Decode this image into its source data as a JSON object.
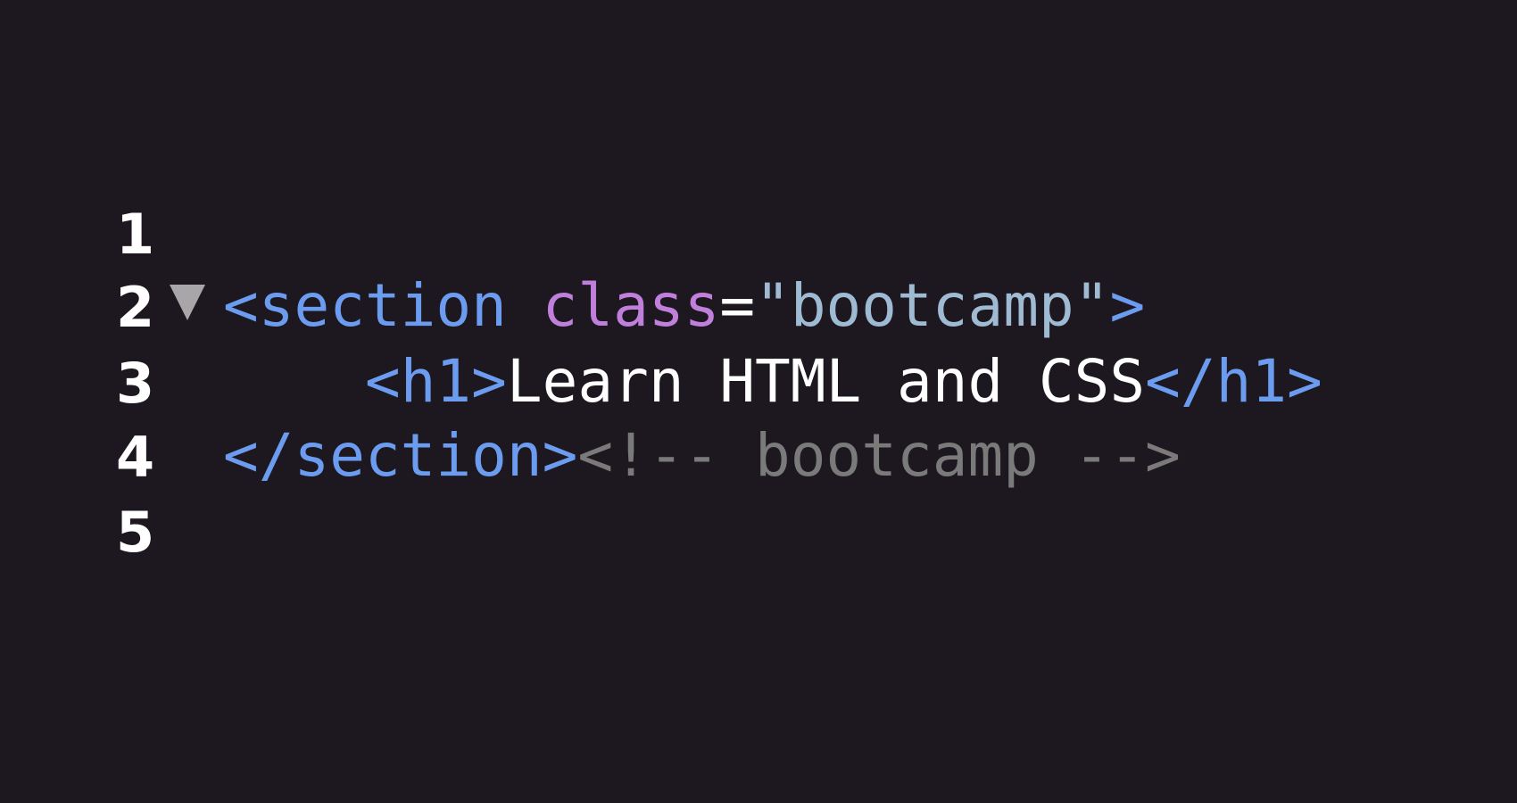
{
  "editor": {
    "colors": {
      "background": "#1d181f",
      "tag": "#6c9cef",
      "attribute": "#c17fdc",
      "string": "#9fbbd4",
      "text": "#ffffff",
      "comment": "#7a7a7a",
      "line_number": "#ffffff",
      "fold_icon": "#a8a6a9"
    },
    "fold_icon": "fold-triangle-down-icon",
    "lines": [
      {
        "number": "1"
      },
      {
        "number": "2",
        "tokens": {
          "open_tag": "<section",
          "space": " ",
          "attr_name": "class",
          "equals": "=",
          "attr_value": "\"bootcamp\"",
          "close_bracket": ">"
        }
      },
      {
        "number": "3",
        "tokens": {
          "indent": "    ",
          "open_tag": "<h1>",
          "text": "Learn HTML and CSS",
          "close_tag": "</h1>"
        }
      },
      {
        "number": "4",
        "tokens": {
          "close_tag": "</section>",
          "comment": "<!-- bootcamp -->"
        }
      },
      {
        "number": "5"
      }
    ]
  }
}
